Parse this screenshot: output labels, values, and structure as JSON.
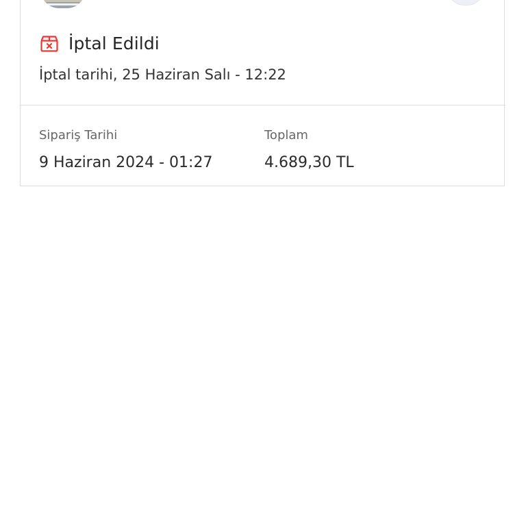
{
  "order": {
    "status": {
      "icon": "cancelled-box-icon",
      "title": "İptal Edildi",
      "cancel_date": "İptal tarihi, 25 Haziran Salı - 12:22",
      "color": "#e53935"
    },
    "details": {
      "order_date_label": "Sipariş Tarihi",
      "order_date_value": "9 Haziran 2024 - 01:27",
      "total_label": "Toplam",
      "total_value": "4.689,30 TL"
    }
  }
}
